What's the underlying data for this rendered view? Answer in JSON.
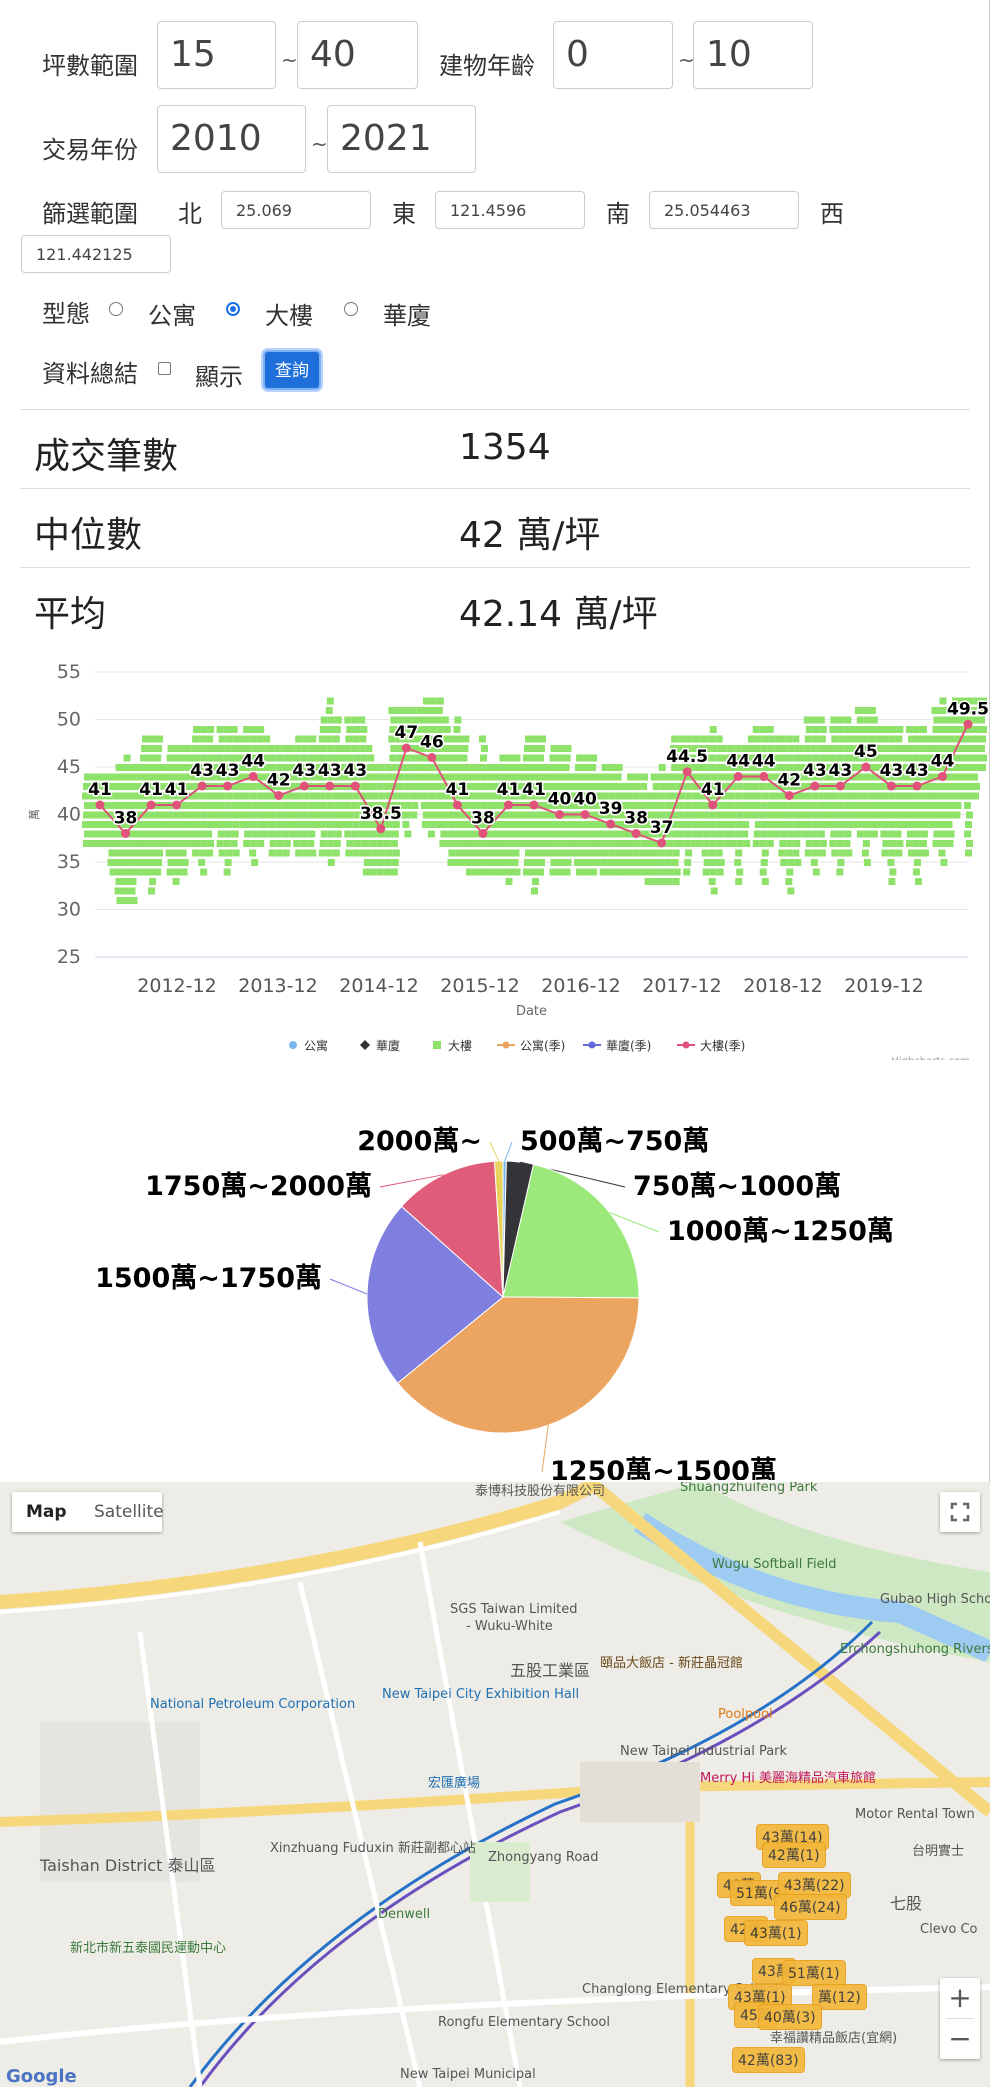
{
  "form": {
    "ping_label": "坪數範圍",
    "ping_min": "15",
    "ping_max": "40",
    "age_label": "建物年齡",
    "age_min": "0",
    "age_max": "10",
    "year_label": "交易年份",
    "year_min": "2010",
    "year_max": "2021",
    "tilde": "~",
    "filter_label": "篩選範圍",
    "north_label": "北",
    "north": "25.069",
    "east_label": "東",
    "east": "121.4596",
    "south_label": "南",
    "south": "25.054463",
    "west_label": "西",
    "west": "121.442125",
    "type_label": "型態",
    "types": [
      "公寓",
      "大樓",
      "華廈"
    ],
    "type_selected": "大樓",
    "summary_label": "資料總結",
    "show_label": "顯示",
    "query_label": "查詢"
  },
  "stats": [
    {
      "label": "成交筆數",
      "value": "1354"
    },
    {
      "label": "中位數",
      "value": "42 萬/坪"
    },
    {
      "label": "平均",
      "value": "42.14 萬/坪"
    }
  ],
  "colors": {
    "green": "#8ee26a",
    "red": "#e0527a",
    "pie_black": "#333338",
    "pie_green": "#9be87b",
    "pie_orange": "#eba561",
    "pie_blue": "#7f7fe0",
    "pie_red": "#e05d7a",
    "pie_yellow": "#e8d259",
    "pie_lightblue": "#7cb5ec",
    "cluster": "#f3b63a",
    "button": "#1e6fd9"
  },
  "chart_data": [
    {
      "type": "line",
      "ylabel": "萬",
      "xlabel": "Date",
      "ylim": [
        25,
        55
      ],
      "yticks": [
        25,
        30,
        35,
        40,
        45,
        50,
        55
      ],
      "xticks": [
        "2012-12",
        "2013-12",
        "2014-12",
        "2015-12",
        "2016-12",
        "2017-12",
        "2018-12",
        "2019-12"
      ],
      "grid": true,
      "legend_position": "bottom",
      "legend": [
        "公寓",
        "華廈",
        "大樓",
        "公寓(季)",
        "華廈(季)",
        "大樓(季)"
      ],
      "credits": "Highcharts.com",
      "series": [
        {
          "name": "大樓(季)",
          "values": [
            41,
            38,
            41,
            41,
            43,
            43,
            44,
            42,
            43,
            43,
            43,
            38.5,
            47,
            46,
            41,
            38,
            41,
            41,
            40,
            40,
            39,
            38,
            37,
            44.5,
            41,
            44,
            44,
            42,
            43,
            43,
            45,
            43,
            43,
            44,
            49.5
          ]
        },
        {
          "name": "大樓",
          "scatter_range_per_quarter": [
            [
              37,
              44
            ],
            [
              31,
              46
            ],
            [
              32,
              48
            ],
            [
              33,
              47
            ],
            [
              34,
              49
            ],
            [
              34,
              49
            ],
            [
              35,
              49
            ],
            [
              36,
              47
            ],
            [
              36,
              48
            ],
            [
              35,
              52
            ],
            [
              36,
              50
            ],
            [
              34,
              45
            ],
            [
              38,
              51
            ],
            [
              38,
              52
            ],
            [
              35,
              50
            ],
            [
              34,
              48
            ],
            [
              33,
              46
            ],
            [
              32,
              48
            ],
            [
              34,
              47
            ],
            [
              34,
              46
            ],
            [
              34,
              45
            ],
            [
              34,
              44
            ],
            [
              33,
              45
            ],
            [
              34,
              48
            ],
            [
              32,
              49
            ],
            [
              33,
              47
            ],
            [
              33,
              49
            ],
            [
              32,
              48
            ],
            [
              34,
              50
            ],
            [
              34,
              50
            ],
            [
              35,
              51
            ],
            [
              33,
              49
            ],
            [
              33,
              49
            ],
            [
              35,
              52
            ],
            [
              36,
              52
            ]
          ]
        }
      ]
    },
    {
      "type": "pie",
      "categories": [
        "500萬~750萬",
        "750萬~1000萬",
        "1000萬~1250萬",
        "1250萬~1500萬",
        "1500萬~1750萬",
        "1750萬~2000萬",
        "2000萬~"
      ],
      "values": [
        0.4,
        3.2,
        21.5,
        39.0,
        22.5,
        12.4,
        1.0
      ]
    }
  ],
  "map": {
    "map_label": "Map",
    "satellite_label": "Satellite",
    "zoom_in": "+",
    "zoom_out": "−",
    "fullscreen_icon": "fullscreen-icon",
    "google": "Google",
    "places": [
      "泰博科技股份有限公司",
      "Shuangzhuifeng Park",
      "SGS Taiwan Limited",
      "- Wuku-White",
      "五股工業區",
      "Wugu Softball Field",
      "頤品大飯店 - 新莊晶冠館",
      "New Taipei City Exhibition Hall",
      "National Petroleum Corporation",
      "宏匯廣場",
      "Poolpool",
      "New Taipei Industrial Park",
      "Merry Hi 美麗海精品汽車旅館",
      "Motor Rental Town",
      "Xinzhuang Fuduxin 新莊副都心站",
      "Denwell",
      "Zhongyang Road",
      "Taishan District 泰山區",
      "新北市新五泰國民運動中心",
      "Erchongshuhong Riverside Park",
      "Changlong Elementary School",
      "Rongfu Elementary School",
      "New Taipei Municipal",
      "Gubao High School",
      "Clevo Co",
      "幸福讚精品飯店(宜網)",
      "台明實士",
      "七股"
    ],
    "clusters": [
      "43萬(14)",
      "42萬(1)",
      "40萬",
      "51萬(9)",
      "43萬(22)",
      "46萬(24)",
      "42萬",
      "43萬(1)",
      "43萬",
      "51萬(1)",
      "43萬(1)",
      "萬(12)",
      "45萬",
      "40萬(3)",
      "42萬(83)"
    ]
  }
}
